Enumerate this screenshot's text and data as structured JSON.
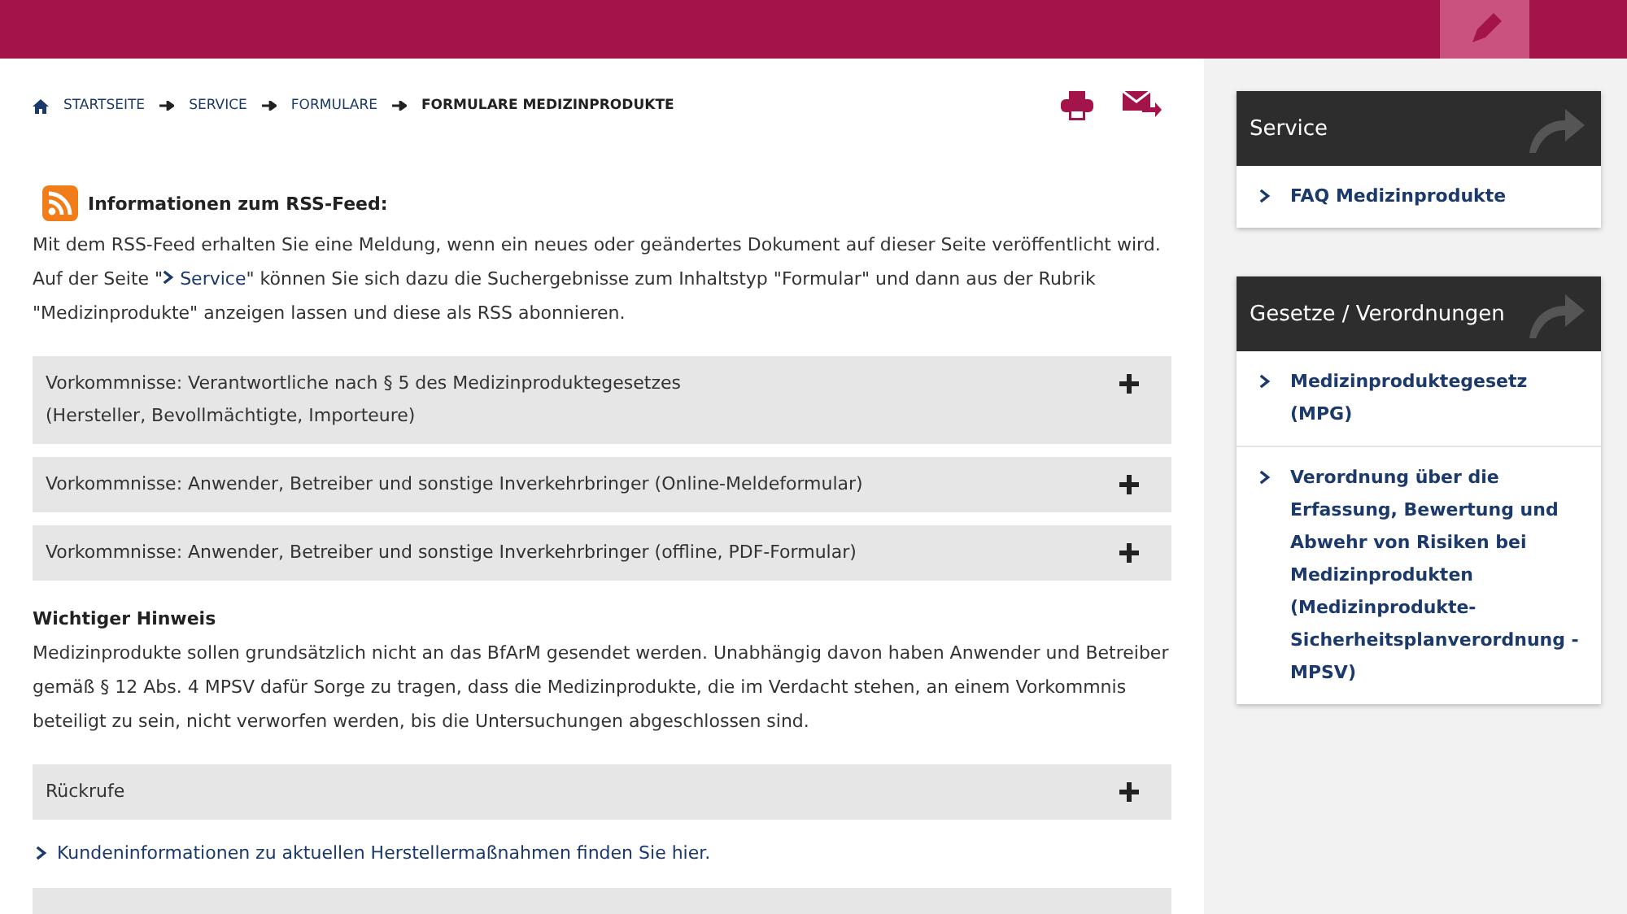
{
  "breadcrumb": [
    {
      "label": "STARTSEITE",
      "current": false
    },
    {
      "label": "SERVICE",
      "current": false
    },
    {
      "label": "FORMULARE",
      "current": false
    },
    {
      "label": "FORMULARE MEDIZINPRODUKTE",
      "current": true
    }
  ],
  "rss": {
    "heading": "Informationen zum RSS-Feed:",
    "text_before": "Mit dem RSS-Feed erhalten Sie eine Meldung, wenn ein neues oder geändertes Dokument auf dieser Seite veröffentlicht wird. Auf der Seite \"",
    "link": "Service",
    "text_after": "\" können Sie sich dazu die Suchergebnisse zum Inhaltstyp \"Formular\" und dann aus der Rubrik \"Medizinprodukte\" anzeigen lassen und diese als RSS abonnieren."
  },
  "accordions_1": [
    {
      "label": "Vorkommnisse: Verantwortliche nach § 5 des Medizinproduktegesetzes\n(Hersteller, Bevollmächtigte, Importeure)",
      "expanded": false
    },
    {
      "label": "Vorkommnisse: Anwender, Betreiber und sonstige Inverkehrbringer (Online-Meldeformular)",
      "expanded": false
    },
    {
      "label": "Vorkommnisse: Anwender, Betreiber und sonstige Inverkehrbringer (offline, PDF-Formular)",
      "expanded": false
    }
  ],
  "notice": {
    "title": "Wichtiger Hinweis",
    "text": "Medizinprodukte sollen grundsätzlich nicht an das BfArM gesendet werden. Unabhängig davon haben Anwender und Betreiber gemäß § 12 Abs. 4 MPSV dafür Sorge zu tragen, dass die Medizinprodukte, die im Verdacht stehen, an einem Vorkommnis beteiligt zu sein, nicht verworfen werden, bis die Untersuchungen abgeschlossen sind."
  },
  "accordions_2": [
    {
      "label": "Rückrufe",
      "expanded": false
    }
  ],
  "recall_link": "Kundeninformationen zu aktuellen Herstellermaßnahmen finden Sie hier.",
  "sidebar": [
    {
      "title": "Service",
      "links": [
        "FAQ Medizinprodukte"
      ]
    },
    {
      "title": "Gesetze / Verordnungen",
      "links": [
        "Medizinproduktegesetz (MPG)",
        "Verordnung über die Erfassung, Bewertung und Abwehr von Risiken bei Medizinprodukten (Medizinprodukte-Sicherheitsplanverordnung - MPSV)"
      ]
    }
  ]
}
